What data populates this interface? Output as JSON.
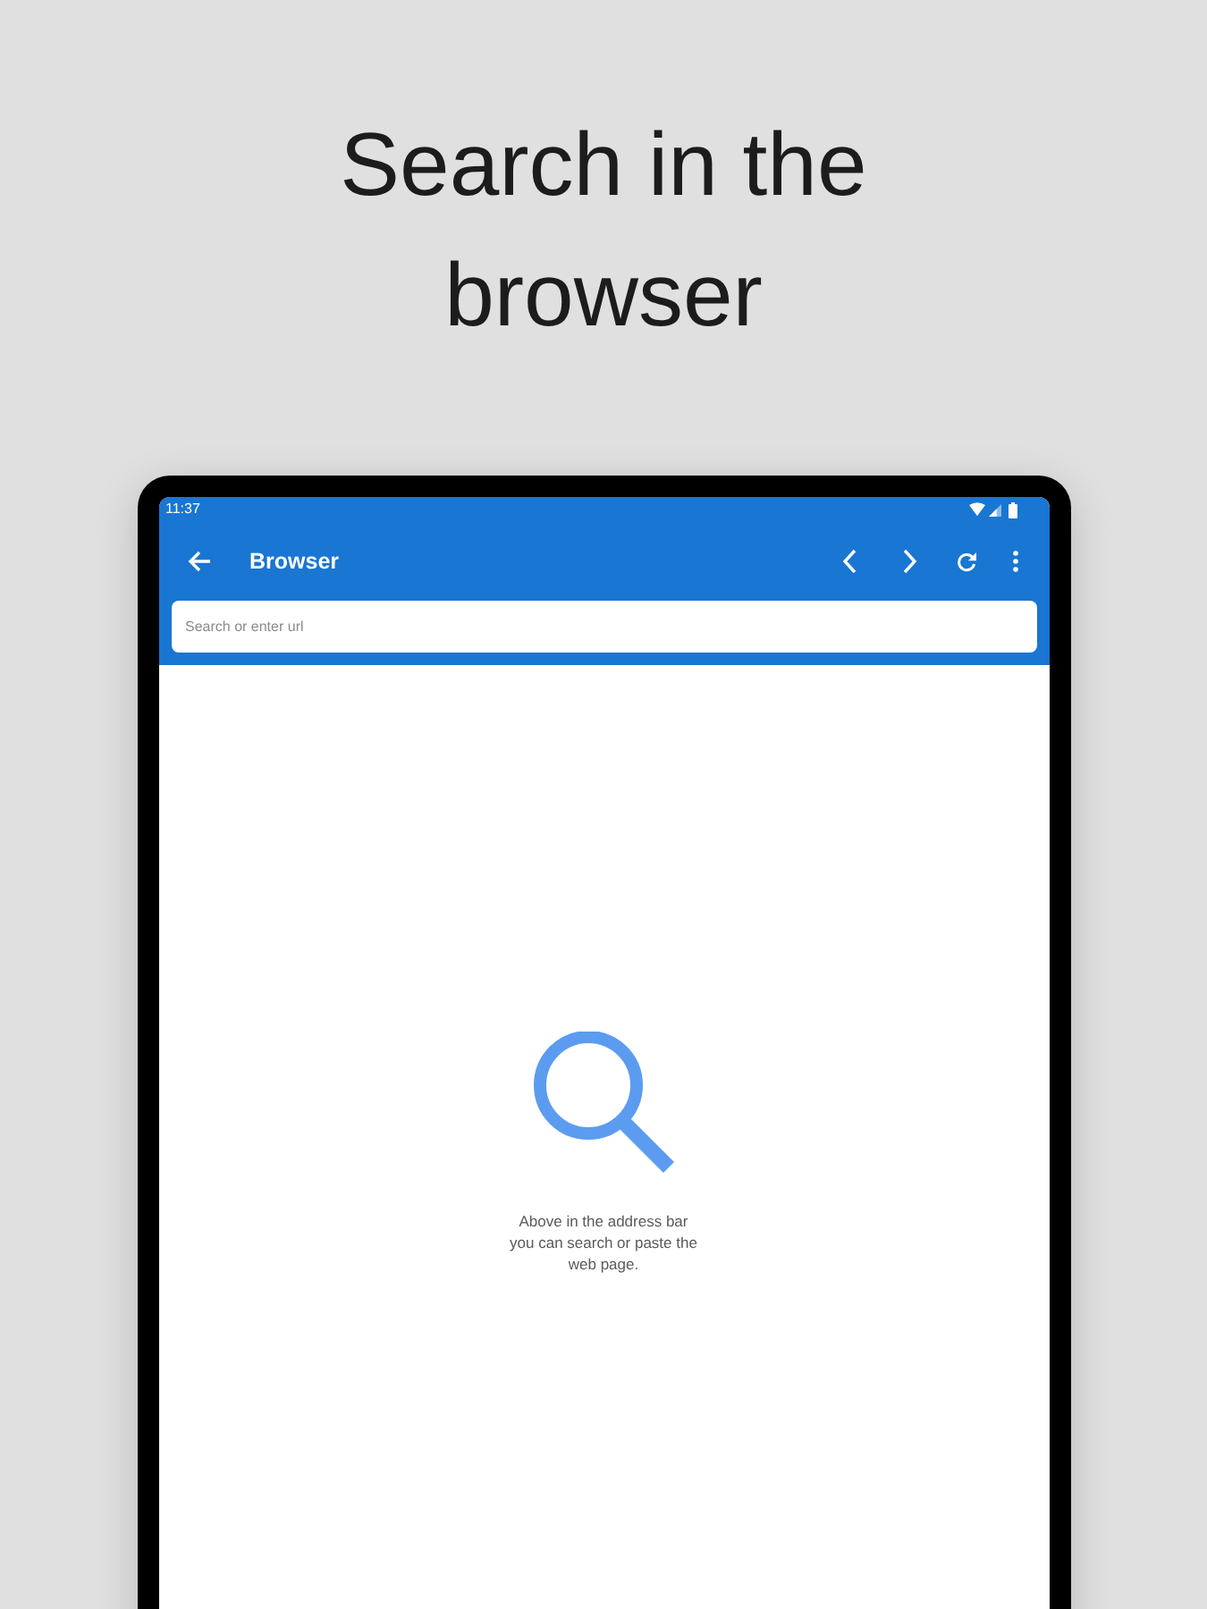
{
  "heading": "Search in the browser",
  "status_bar": {
    "time": "11:37"
  },
  "toolbar": {
    "title": "Browser"
  },
  "address_bar": {
    "placeholder": "Search or enter url"
  },
  "empty_state": {
    "message": "Above in the address bar\nyou can search or paste the\nweb page."
  }
}
